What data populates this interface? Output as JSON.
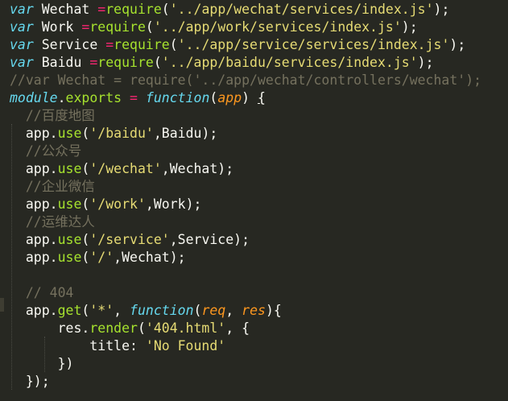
{
  "editor": {
    "theme_colors": {
      "background": "#272822",
      "keyword": "#66d9ef",
      "string": "#e6db74",
      "operator": "#f92672",
      "comment": "#75715e",
      "function_call": "#a6e22e",
      "parameter": "#fd971f",
      "text": "#f8f8f2"
    },
    "lines": [
      [
        [
          "var",
          "kw"
        ],
        [
          " Wechat ",
          "plain"
        ],
        [
          "=",
          "op"
        ],
        [
          "require",
          "call"
        ],
        [
          "(",
          "plain"
        ],
        [
          "'../app/wechat/services/index.js'",
          "str"
        ],
        [
          ");",
          "plain"
        ]
      ],
      [
        [
          "var",
          "kw"
        ],
        [
          " Work ",
          "plain"
        ],
        [
          "=",
          "op"
        ],
        [
          "require",
          "call"
        ],
        [
          "(",
          "plain"
        ],
        [
          "'../app/work/services/index.js'",
          "str"
        ],
        [
          ");",
          "plain"
        ]
      ],
      [
        [
          "var",
          "kw"
        ],
        [
          " Service ",
          "plain"
        ],
        [
          "=",
          "op"
        ],
        [
          "require",
          "call"
        ],
        [
          "(",
          "plain"
        ],
        [
          "'../app/service/services/index.js'",
          "str"
        ],
        [
          ");",
          "plain"
        ]
      ],
      [
        [
          "var",
          "kw"
        ],
        [
          " Baidu ",
          "plain"
        ],
        [
          "=",
          "op"
        ],
        [
          "require",
          "call"
        ],
        [
          "(",
          "plain"
        ],
        [
          "'../app/baidu/services/index.js'",
          "str"
        ],
        [
          ");",
          "plain"
        ]
      ],
      [
        [
          "//var Wechat = require('../app/wechat/controllers/wechat');",
          "cm"
        ]
      ],
      [
        [
          "module",
          "kw"
        ],
        [
          ".",
          "plain"
        ],
        [
          "exports",
          "call"
        ],
        [
          " ",
          "plain"
        ],
        [
          "=",
          "op"
        ],
        [
          " ",
          "plain"
        ],
        [
          "function",
          "fn-kw"
        ],
        [
          "(",
          "plain"
        ],
        [
          "app",
          "param"
        ],
        [
          ") ",
          "plain"
        ],
        [
          "{",
          "brace-match"
        ]
      ],
      [
        [
          "  ",
          "plain"
        ],
        [
          "//百度地图",
          "cm"
        ]
      ],
      [
        [
          "  app.",
          "plain"
        ],
        [
          "use",
          "call"
        ],
        [
          "(",
          "plain"
        ],
        [
          "'/baidu'",
          "str"
        ],
        [
          ",Baidu);",
          "plain"
        ]
      ],
      [
        [
          "  ",
          "plain"
        ],
        [
          "//公众号",
          "cm"
        ]
      ],
      [
        [
          "  app.",
          "plain"
        ],
        [
          "use",
          "call"
        ],
        [
          "(",
          "plain"
        ],
        [
          "'/wechat'",
          "str"
        ],
        [
          ",Wechat);",
          "plain"
        ]
      ],
      [
        [
          "  ",
          "plain"
        ],
        [
          "//企业微信",
          "cm"
        ]
      ],
      [
        [
          "  app.",
          "plain"
        ],
        [
          "use",
          "call"
        ],
        [
          "(",
          "plain"
        ],
        [
          "'/work'",
          "str"
        ],
        [
          ",Work);",
          "plain"
        ]
      ],
      [
        [
          "  ",
          "plain"
        ],
        [
          "//运维达人",
          "cm"
        ]
      ],
      [
        [
          "  app.",
          "plain"
        ],
        [
          "use",
          "call"
        ],
        [
          "(",
          "plain"
        ],
        [
          "'/service'",
          "str"
        ],
        [
          ",Service);",
          "plain"
        ]
      ],
      [
        [
          "  app.",
          "plain"
        ],
        [
          "use",
          "call"
        ],
        [
          "(",
          "plain"
        ],
        [
          "'/'",
          "str"
        ],
        [
          ",Wechat);",
          "plain"
        ]
      ],
      [
        [
          "",
          "plain"
        ]
      ],
      [
        [
          "  ",
          "plain"
        ],
        [
          "// 404",
          "cm"
        ]
      ],
      [
        [
          "  app.",
          "plain"
        ],
        [
          "get",
          "call"
        ],
        [
          "(",
          "plain"
        ],
        [
          "'*'",
          "str"
        ],
        [
          ", ",
          "plain"
        ],
        [
          "function",
          "fn-kw"
        ],
        [
          "(",
          "plain"
        ],
        [
          "req",
          "param"
        ],
        [
          ", ",
          "plain"
        ],
        [
          "res",
          "param"
        ],
        [
          "){",
          "plain"
        ]
      ],
      [
        [
          "      res.",
          "plain"
        ],
        [
          "render",
          "call"
        ],
        [
          "(",
          "plain"
        ],
        [
          "'404.html'",
          "str"
        ],
        [
          ", {",
          "plain"
        ]
      ],
      [
        [
          "          title: ",
          "plain"
        ],
        [
          "'No Found'",
          "str"
        ]
      ],
      [
        [
          "      })",
          "plain"
        ]
      ],
      [
        [
          "  });",
          "plain"
        ]
      ]
    ]
  }
}
